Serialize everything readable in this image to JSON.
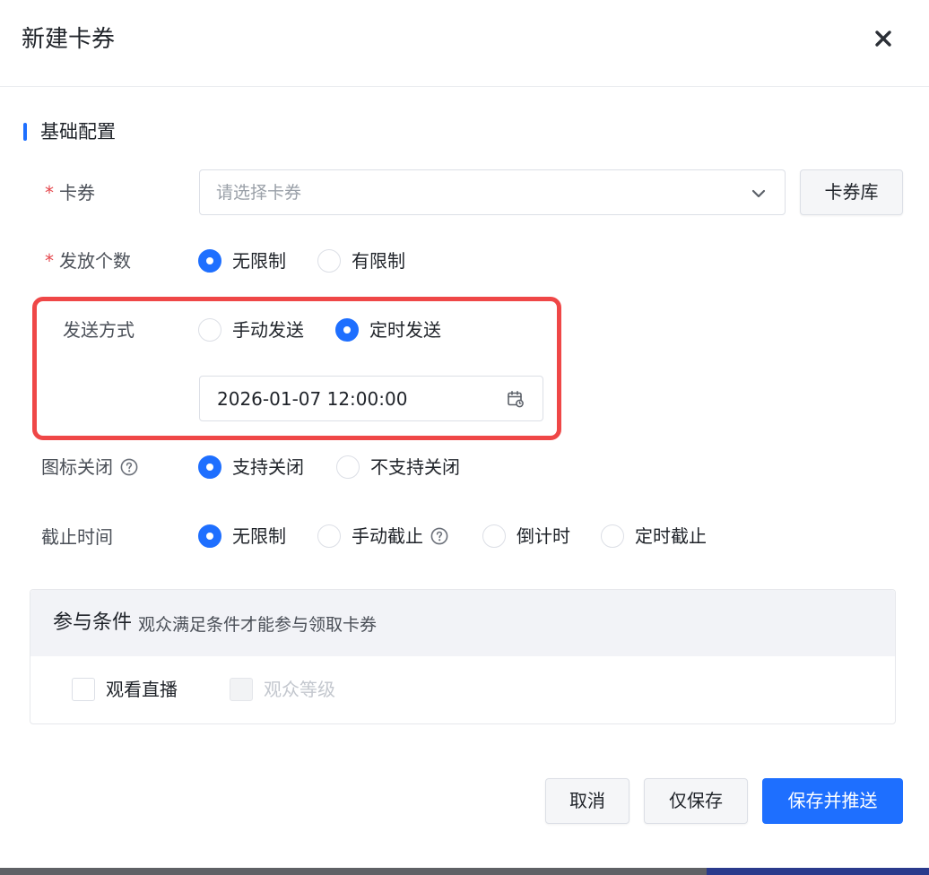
{
  "dialog": {
    "title": "新建卡券",
    "close_icon": "close-icon"
  },
  "section": {
    "title": "基础配置"
  },
  "coupon": {
    "label": "卡券",
    "required_mark": "*",
    "placeholder": "请选择卡券",
    "library_button": "卡券库"
  },
  "issue_count": {
    "label": "发放个数",
    "required_mark": "*",
    "options": [
      "无限制",
      "有限制"
    ],
    "selected": "无限制"
  },
  "send_mode": {
    "label": "发送方式",
    "options": [
      "手动发送",
      "定时发送"
    ],
    "selected": "定时发送",
    "datetime_value": "2026-01-07 12:00:00",
    "highlight_color": "#ef4747"
  },
  "icon_close": {
    "label": "图标关闭",
    "options": [
      "支持关闭",
      "不支持关闭"
    ],
    "selected": "支持关闭"
  },
  "deadline": {
    "label": "截止时间",
    "options": [
      "无限制",
      "手动截止",
      "倒计时",
      "定时截止"
    ],
    "selected": "无限制"
  },
  "conditions": {
    "title": "参与条件",
    "subtitle": "观众满足条件才能参与领取卡券",
    "options": [
      {
        "label": "观看直播",
        "checked": false,
        "disabled": false
      },
      {
        "label": "观众等级",
        "checked": false,
        "disabled": true
      }
    ]
  },
  "footer": {
    "cancel": "取消",
    "save_only": "仅保存",
    "save_and_push": "保存并推送"
  },
  "colors": {
    "primary": "#1e6fff",
    "required": "#e5484d"
  }
}
